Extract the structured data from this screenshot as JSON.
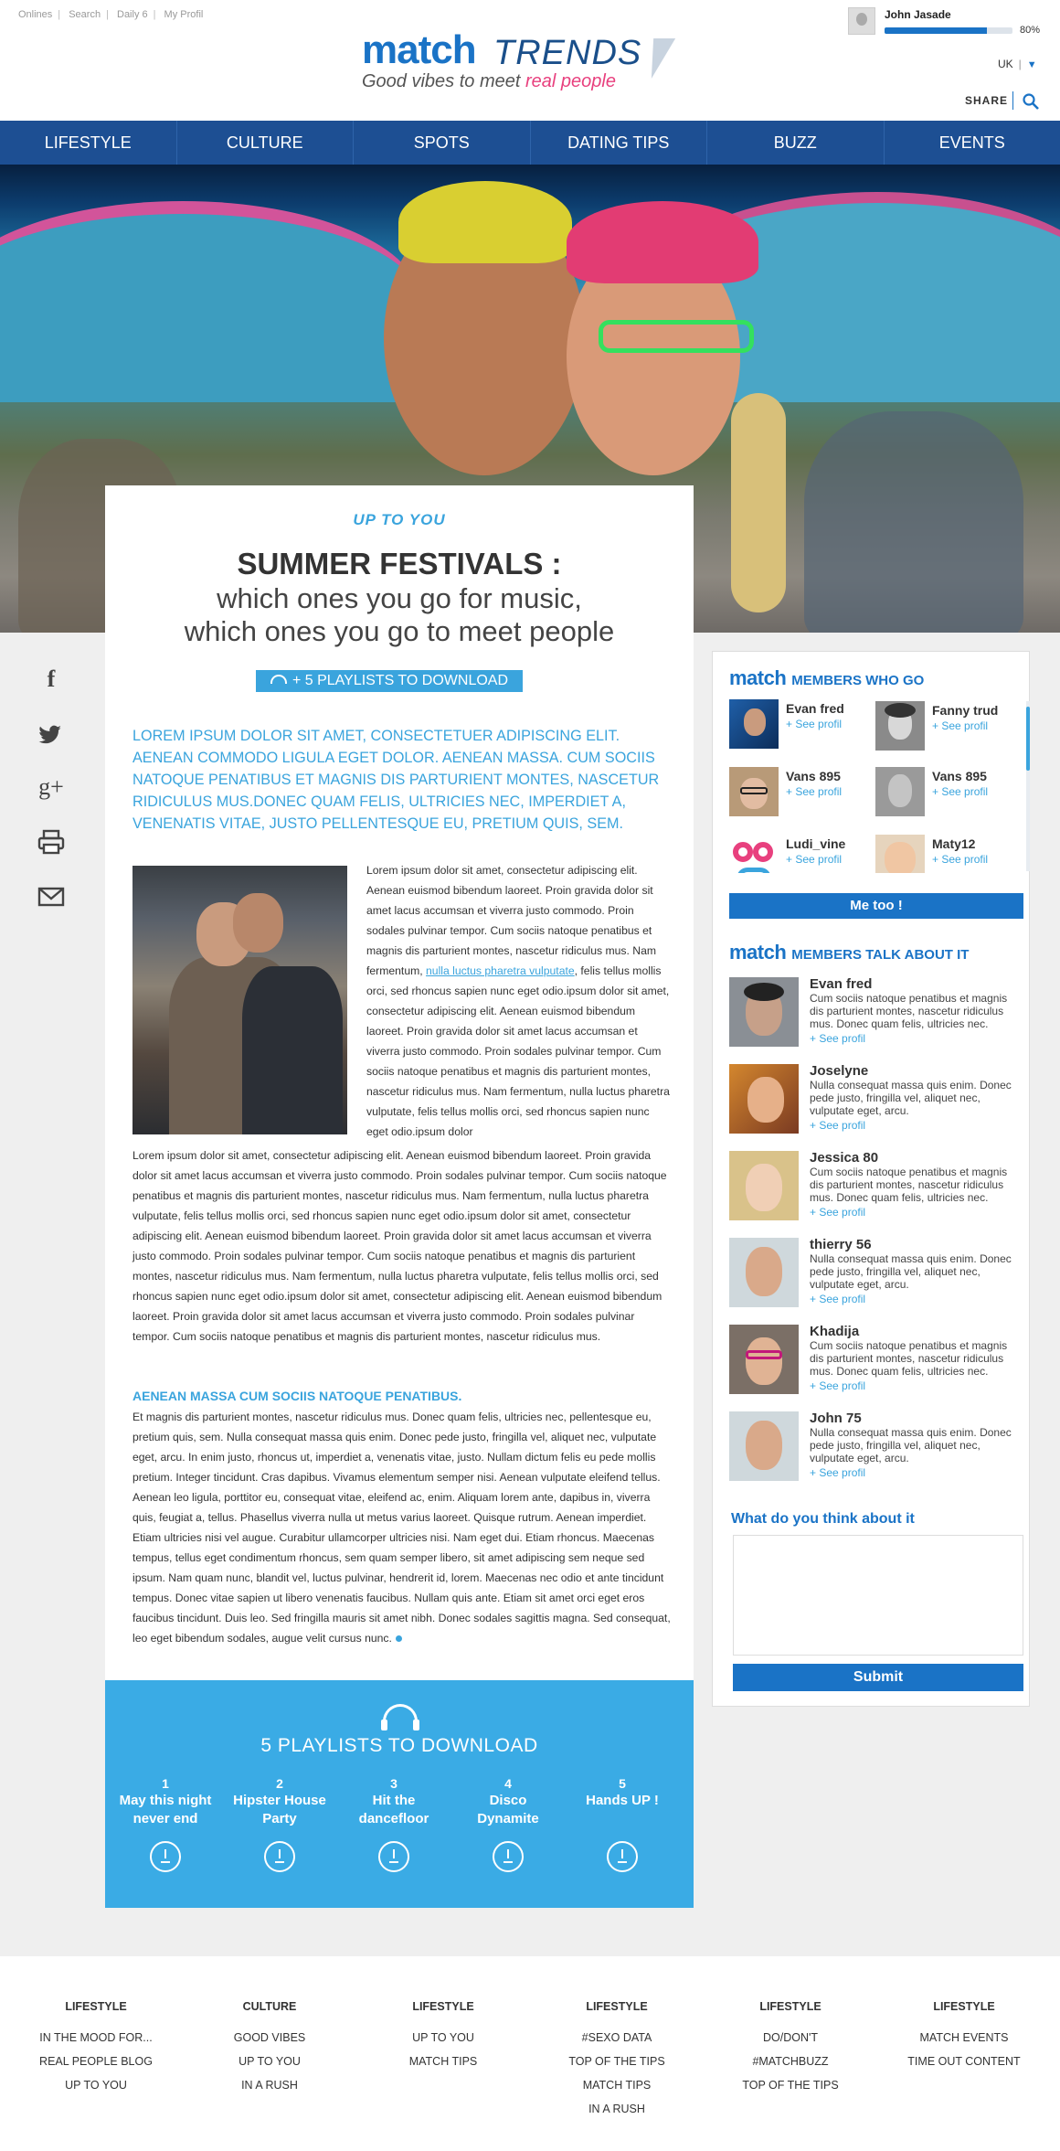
{
  "toplinks": [
    "Onlines",
    "Search",
    "Daily 6",
    "My Profil"
  ],
  "logo": {
    "brand": "match",
    "trends": "TRENDS",
    "tagline_start": "Good vibes to meet",
    "tagline_pink": "real people"
  },
  "user": {
    "name": "John Jasade",
    "progress": 0.8,
    "progress_label": "80%"
  },
  "lang": "UK",
  "share": "SHARE",
  "nav": [
    "LIFESTYLE",
    "CULTURE",
    "SPOTS",
    "DATING TIPS",
    "BUZZ",
    "EVENTS"
  ],
  "article": {
    "kicker": "UP TO YOU",
    "title1": "SUMMER FESTIVALS :",
    "title2": "which ones you go for music,",
    "title3": "which ones you go to meet people",
    "download_btn": "+ 5 PLAYLISTS TO DOWNLOAD",
    "lead": "LOREM IPSUM DOLOR SIT AMET, CONSECTETUER ADIPISCING ELIT. AENEAN COMMODO LIGULA EGET DOLOR. AENEAN MASSA. CUM SOCIIS NATOQUE PENATIBUS ET MAGNIS DIS PARTURIENT MONTES, NASCETUR RIDICULUS MUS.DONEC QUAM FELIS, ULTRICIES NEC,  IMPERDIET A, VENENATIS VITAE, JUSTO PELLENTESQUE EU, PRETIUM QUIS, SEM.",
    "body1_a": "Lorem ipsum dolor sit amet, consectetur adipiscing elit. Aenean euismod bibendum laoreet. Proin gravida dolor sit amet lacus accumsan et viverra justo commodo. Proin sodales pulvinar tempor. Cum sociis natoque penatibus et magnis dis parturient montes, nascetur ridiculus mus. Nam fermentum, ",
    "body1_link": "nulla luctus pharetra vulputate",
    "body1_b": ", felis tellus mollis orci, sed rhoncus sapien nunc eget odio.ipsum dolor sit amet, consectetur adipiscing elit. Aenean euismod bibendum laoreet. Proin gravida dolor sit amet lacus accumsan et viverra justo commodo. Proin sodales pulvinar tempor. Cum sociis natoque penatibus et magnis dis parturient montes, nascetur ridiculus mus. Nam fermentum, nulla luctus pharetra vulputate, felis tellus mollis orci, sed rhoncus sapien nunc eget odio.ipsum dolor",
    "body2": "Lorem ipsum dolor sit amet, consectetur adipiscing elit. Aenean euismod bibendum laoreet. Proin gravida dolor sit amet lacus accumsan et viverra justo commodo. Proin sodales pulvinar tempor. Cum sociis natoque penatibus et magnis dis parturient montes, nascetur ridiculus mus. Nam fermentum, nulla luctus pharetra vulputate, felis tellus mollis orci, sed rhoncus sapien nunc eget odio.ipsum dolor sit amet, consectetur adipiscing elit. Aenean euismod bibendum laoreet. Proin gravida dolor sit amet lacus accumsan et viverra justo commodo. Proin sodales pulvinar tempor. Cum sociis natoque penatibus et magnis dis parturient montes, nascetur ridiculus mus. Nam fermentum, nulla luctus pharetra vulputate, felis tellus mollis orci, sed rhoncus sapien nunc eget odio.ipsum dolor sit amet, consectetur adipiscing elit. Aenean euismod bibendum laoreet. Proin gravida dolor sit amet lacus accumsan et viverra justo commodo. Proin sodales pulvinar tempor. Cum sociis natoque penatibus et magnis dis parturient montes, nascetur ridiculus mus.",
    "subhead": "AENEAN MASSA CUM SOCIIS NATOQUE PENATIBUS.",
    "body3": "Et magnis dis parturient montes, nascetur ridiculus mus. Donec quam felis, ultricies nec, pellentesque eu, pretium quis, sem. Nulla consequat massa quis enim. Donec pede justo, fringilla vel, aliquet nec, vulputate eget, arcu. In enim justo, rhoncus ut, imperdiet a, venenatis vitae, justo. Nullam dictum felis eu pede mollis pretium. Integer tincidunt. Cras dapibus. Vivamus elementum semper nisi. Aenean vulputate eleifend tellus. Aenean leo ligula, porttitor eu, consequat vitae, eleifend ac, enim. Aliquam lorem ante, dapibus in, viverra quis, feugiat a, tellus. Phasellus viverra nulla ut metus varius laoreet. Quisque rutrum. Aenean imperdiet. Etiam ultricies nisi vel augue. Curabitur ullamcorper ultricies nisi. Nam eget dui. Etiam rhoncus. Maecenas tempus, tellus eget condimentum rhoncus, sem quam semper libero, sit amet adipiscing sem neque sed ipsum. Nam quam nunc, blandit vel, luctus pulvinar, hendrerit id, lorem. Maecenas nec odio et ante tincidunt tempus. Donec vitae sapien ut libero venenatis faucibus. Nullam quis ante. Etiam sit amet orci eget eros faucibus tincidunt. Duis leo. Sed fringilla mauris sit amet nibh. Donec sodales sagittis magna. Sed consequat, leo eget bibendum sodales, augue velit cursus nunc."
  },
  "playlists": {
    "title": "5 PLAYLISTS TO DOWNLOAD",
    "items": [
      {
        "num": "1",
        "line1": "May this night",
        "line2": "never end"
      },
      {
        "num": "2",
        "line1": "Hipster House",
        "line2": "Party"
      },
      {
        "num": "3",
        "line1": "Hit the",
        "line2": "dancefloor"
      },
      {
        "num": "4",
        "line1": "Disco",
        "line2": "Dynamite"
      },
      {
        "num": "5",
        "line1": "Hands UP !",
        "line2": ""
      }
    ]
  },
  "social": [
    "f",
    "twitter",
    "g+",
    "print",
    "mail"
  ],
  "sidebar": {
    "brand": "match",
    "members_title": "MEMBERS WHO GO",
    "members": [
      {
        "name": "Evan fred",
        "link": "+ See profil"
      },
      {
        "name": "Fanny trud",
        "link": "+ See profil"
      },
      {
        "name": "Vans 895",
        "link": "+ See profil"
      },
      {
        "name": "Vans 895",
        "link": "+ See profil"
      },
      {
        "name": "Ludi_vine",
        "link": "+ See profil"
      },
      {
        "name": "Maty12",
        "link": "+ See profil"
      }
    ],
    "metoo": "Me too !",
    "talk_title": "MEMBERS TALK ABOUT IT",
    "talk": [
      {
        "name": "Evan fred",
        "text": "Cum sociis natoque penatibus et magnis dis parturient montes, nascetur ridiculus mus. Donec quam felis, ultricies nec.",
        "link": "+ See profil"
      },
      {
        "name": "Joselyne",
        "text": "Nulla consequat massa quis enim. Donec pede justo, fringilla vel, aliquet nec, vulputate eget, arcu.",
        "link": "+ See profil"
      },
      {
        "name": "Jessica 80",
        "text": "Cum sociis natoque penatibus et magnis dis parturient montes, nascetur ridiculus mus. Donec quam felis, ultricies nec.",
        "link": "+ See profil"
      },
      {
        "name": "thierry 56",
        "text": "Nulla consequat massa quis enim. Donec pede justo, fringilla vel, aliquet nec, vulputate eget, arcu.",
        "link": "+ See profil"
      },
      {
        "name": "Khadija",
        "text": "Cum sociis natoque penatibus et magnis dis parturient montes, nascetur ridiculus mus. Donec quam felis, ultricies nec.",
        "link": "+ See profil"
      },
      {
        "name": "John 75",
        "text": "Nulla consequat massa quis enim. Donec pede justo, fringilla vel, aliquet nec, vulputate eget, arcu.",
        "link": "+ See profil"
      }
    ],
    "think_title": "What do you think about it",
    "submit": "Submit"
  },
  "footer": [
    {
      "head": "LIFESTYLE",
      "links": [
        "IN THE MOOD FOR...",
        "REAL PEOPLE BLOG",
        "UP TO YOU"
      ]
    },
    {
      "head": "CULTURE",
      "links": [
        "GOOD VIBES",
        "UP TO YOU",
        "IN A RUSH"
      ]
    },
    {
      "head": "LIFESTYLE",
      "links": [
        "UP TO YOU",
        "MATCH TIPS"
      ]
    },
    {
      "head": "LIFESTYLE",
      "links": [
        "#SEXO DATA",
        "TOP OF THE TIPS",
        "MATCH TIPS",
        "IN A RUSH"
      ]
    },
    {
      "head": "LIFESTYLE",
      "links": [
        "DO/DON'T",
        "#MATCHBUZZ",
        "TOP OF THE TIPS"
      ]
    },
    {
      "head": "LIFESTYLE",
      "links": [
        "MATCH EVENTS",
        "TIME OUT CONTENT"
      ]
    }
  ],
  "colors": {
    "brand_blue": "#1a73c6",
    "nav_blue": "#1d4f93",
    "accent_cyan": "#3aa4dd",
    "pink": "#e8407e"
  }
}
